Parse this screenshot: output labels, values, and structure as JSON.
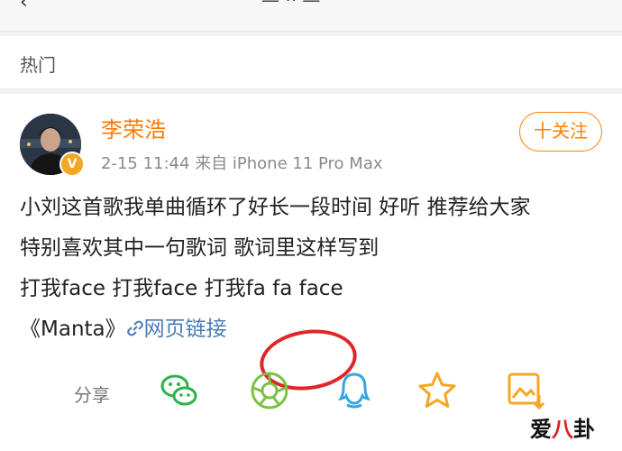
{
  "section": {
    "label": "热门"
  },
  "post": {
    "author": "李荣浩",
    "verified_badge": "V",
    "timestamp": "2-15 11:44",
    "source": "来自 iPhone 11 Pro Max",
    "follow_label": "十关注",
    "lines": [
      "小刘这首歌我单曲循环了好长一段时间 好听 推荐给大家",
      "特别喜欢其中一句歌词 歌词里这样写到",
      "打我face 打我face 打我fa fa face"
    ],
    "song_title": "《Manta》",
    "link_label": "网页链接"
  },
  "share": {
    "label": "分享",
    "targets": [
      "wechat-icon",
      "moments-icon",
      "qq-icon",
      "favorite-icon",
      "save-image-icon"
    ]
  },
  "watermark": {
    "left": "爱",
    "mid": "八",
    "right": "卦"
  },
  "colors": {
    "accent": "#ff8200",
    "link": "#4a7bb7",
    "annotation": "#e0262a"
  }
}
